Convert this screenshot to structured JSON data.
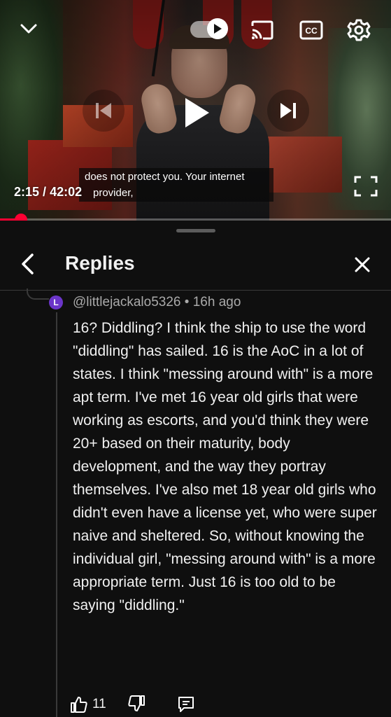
{
  "player": {
    "time_current": "2:15",
    "time_total": "42:02",
    "caption_line1": "does not protect you. Your internet",
    "caption_line2": "provider,",
    "progress_fraction": 0.0535,
    "accent_color": "#ff0033",
    "icons": [
      "chevron-down-icon",
      "autoplay-toggle-icon",
      "cast-icon",
      "cc-icon",
      "settings-icon",
      "previous-icon",
      "play-icon",
      "next-icon",
      "fullscreen-icon"
    ]
  },
  "panel": {
    "title": "Replies",
    "back_icon": "chevron-left-icon",
    "close_icon": "close-icon"
  },
  "comment": {
    "avatar_letter": "L",
    "avatar_color": "#6b35c9",
    "author": "@littlejackalo5326",
    "age": "16h ago",
    "text": "16? Diddling? I think the ship to use the word \"diddling\" has sailed. 16 is the AoC in a lot of states. I think \"messing around with\" is a more apt term. I've met 16 year old girls that were working as escorts, and you'd think they were 20+ based on their maturity, body development, and the way they portray themselves. I've also met 18 year old girls who didn't even have a license yet, who were super naive and sheltered. So, without knowing the individual girl, \"messing around with\" is a more appropriate term. Just 16 is too old to be saying \"diddling.\"",
    "likes": "11",
    "icons": [
      "thumbs-up-icon",
      "thumbs-down-icon",
      "reply-icon"
    ]
  }
}
